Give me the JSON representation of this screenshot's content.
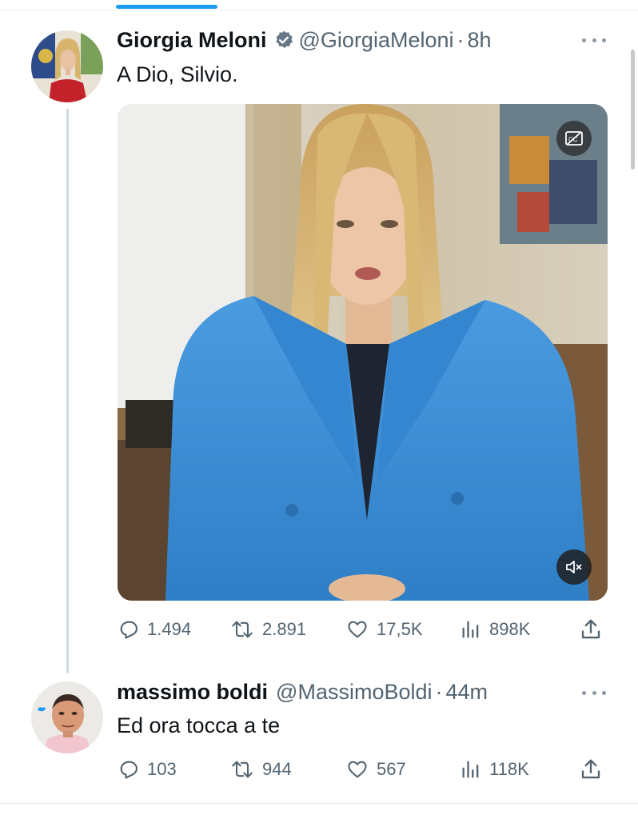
{
  "tweets": [
    {
      "display_name": "Giorgia Meloni",
      "handle": "@GiorgiaMeloni",
      "separator": "·",
      "time": "8h",
      "text": "A Dio, Silvio.",
      "verified": true,
      "metrics": {
        "replies": "1.494",
        "retweets": "2.891",
        "likes": "17,5K",
        "views": "898K"
      }
    },
    {
      "display_name": "massimo boldi",
      "handle": "@MassimoBoldi",
      "separator": "·",
      "time": "44m",
      "text": "Ed ora tocca a te",
      "verified": false,
      "metrics": {
        "replies": "103",
        "retweets": "944",
        "likes": "567",
        "views": "118K"
      }
    }
  ],
  "media": {
    "captions_icon": "closed-captions-off-icon",
    "mute_icon": "volume-muted-icon"
  },
  "colors": {
    "accent": "#1d9bf0",
    "secondary_text": "#536471",
    "blazer": "#3d8fd6"
  }
}
